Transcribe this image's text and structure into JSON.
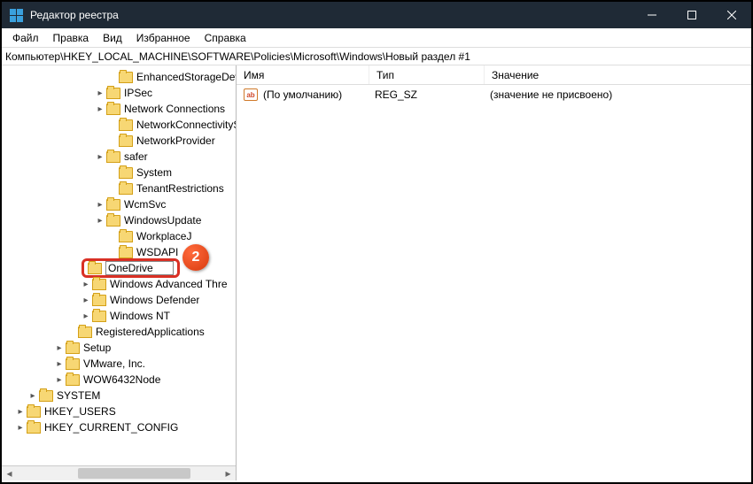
{
  "window": {
    "title": "Редактор реестра"
  },
  "menu": {
    "file": "Файл",
    "edit": "Правка",
    "view": "Вид",
    "favorites": "Избранное",
    "help": "Справка"
  },
  "address": "Компьютер\\HKEY_LOCAL_MACHINE\\SOFTWARE\\Policies\\Microsoft\\Windows\\Новый раздел #1",
  "tree": [
    {
      "indent": 118,
      "exp": "",
      "label": "EnhancedStorageDevi"
    },
    {
      "indent": 104,
      "exp": "▸",
      "label": "IPSec"
    },
    {
      "indent": 104,
      "exp": "▸",
      "label": "Network Connections"
    },
    {
      "indent": 118,
      "exp": "",
      "label": "NetworkConnectivityS"
    },
    {
      "indent": 118,
      "exp": "",
      "label": "NetworkProvider"
    },
    {
      "indent": 104,
      "exp": "▸",
      "label": "safer"
    },
    {
      "indent": 118,
      "exp": "",
      "label": "System"
    },
    {
      "indent": 118,
      "exp": "",
      "label": "TenantRestrictions"
    },
    {
      "indent": 104,
      "exp": "▸",
      "label": "WcmSvc"
    },
    {
      "indent": 104,
      "exp": "▸",
      "label": "WindowsUpdate"
    },
    {
      "indent": 118,
      "exp": "",
      "label": "WorkplaceJ"
    },
    {
      "indent": 118,
      "exp": "",
      "label": "WSDAPI"
    },
    {
      "indent": 88,
      "exp": "▸",
      "label": "Windows Advanced Thre"
    },
    {
      "indent": 88,
      "exp": "▸",
      "label": "Windows Defender"
    },
    {
      "indent": 88,
      "exp": "▸",
      "label": "Windows NT"
    },
    {
      "indent": 72,
      "exp": "",
      "label": "RegisteredApplications"
    },
    {
      "indent": 58,
      "exp": "▸",
      "label": "Setup"
    },
    {
      "indent": 58,
      "exp": "▸",
      "label": "VMware, Inc."
    },
    {
      "indent": 58,
      "exp": "▸",
      "label": "WOW6432Node"
    },
    {
      "indent": 28,
      "exp": "▸",
      "label": "SYSTEM"
    },
    {
      "indent": 14,
      "exp": "▸",
      "label": "HKEY_USERS"
    },
    {
      "indent": 14,
      "exp": "▸",
      "label": "HKEY_CURRENT_CONFIG"
    }
  ],
  "edit": {
    "value": "OneDrive",
    "indent": 90
  },
  "badge": "2",
  "columns": {
    "name": "Имя",
    "type": "Тип",
    "value": "Значение"
  },
  "default_row": {
    "name": "(По умолчанию)",
    "type": "REG_SZ",
    "value": "(значение не присвоено)",
    "icon": "ab"
  }
}
